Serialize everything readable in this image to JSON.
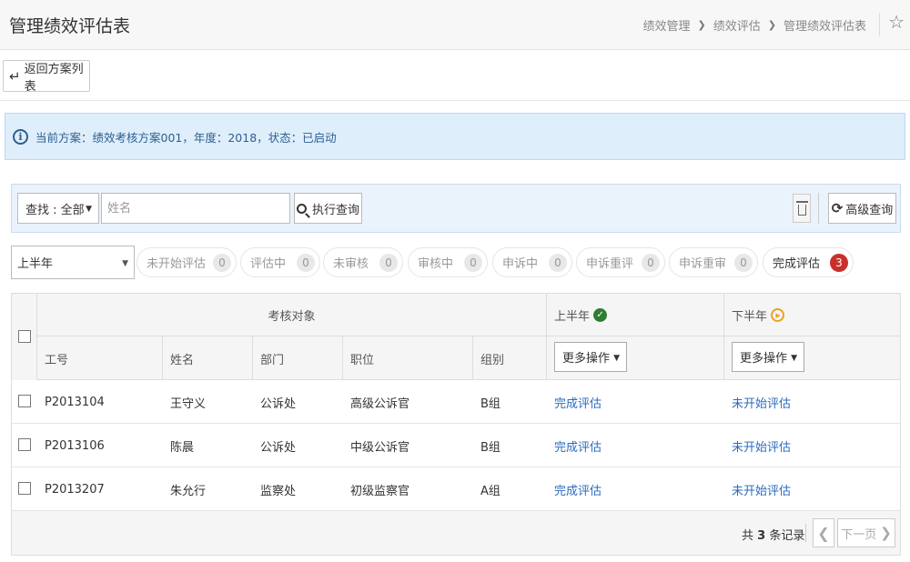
{
  "header": {
    "title": "管理绩效评估表",
    "breadcrumb": [
      "绩效管理",
      "绩效评估",
      "管理绩效评估表"
    ]
  },
  "back_button": {
    "label": "返回方案列表"
  },
  "info": {
    "text": "当前方案：绩效考核方案001，年度：2018，状态：已启动"
  },
  "filter": {
    "find_label": "查找 : 全部",
    "name_placeholder": "姓名",
    "query_label": "执行查询",
    "advanced_label": "高级查询"
  },
  "period": {
    "selected": "上半年"
  },
  "statuses": [
    {
      "label": "未开始评估",
      "count": "0"
    },
    {
      "label": "评估中",
      "count": "0"
    },
    {
      "label": "未审核",
      "count": "0"
    },
    {
      "label": "审核中",
      "count": "0"
    },
    {
      "label": "申诉中",
      "count": "0"
    },
    {
      "label": "申诉重评",
      "count": "0"
    },
    {
      "label": "申诉重审",
      "count": "0"
    },
    {
      "label": "完成评估",
      "count": "3"
    }
  ],
  "table": {
    "group_headers": {
      "target": "考核对象",
      "first_half": "上半年",
      "second_half": "下半年"
    },
    "columns": [
      "工号",
      "姓名",
      "部门",
      "职位",
      "组别"
    ],
    "more_ops": "更多操作",
    "rows": [
      {
        "id": "P2013104",
        "name": "王守义",
        "dept": "公诉处",
        "position": "高级公诉官",
        "group": "B组",
        "first": "完成评估",
        "second": "未开始评估"
      },
      {
        "id": "P2013106",
        "name": "陈晨",
        "dept": "公诉处",
        "position": "中级公诉官",
        "group": "B组",
        "first": "完成评估",
        "second": "未开始评估"
      },
      {
        "id": "P2013207",
        "name": "朱允行",
        "dept": "监察处",
        "position": "初级监察官",
        "group": "A组",
        "first": "完成评估",
        "second": "未开始评估"
      }
    ]
  },
  "pagination": {
    "total_prefix": "共",
    "total_count": "3",
    "total_suffix": "条记录",
    "next_label": "下一页"
  }
}
